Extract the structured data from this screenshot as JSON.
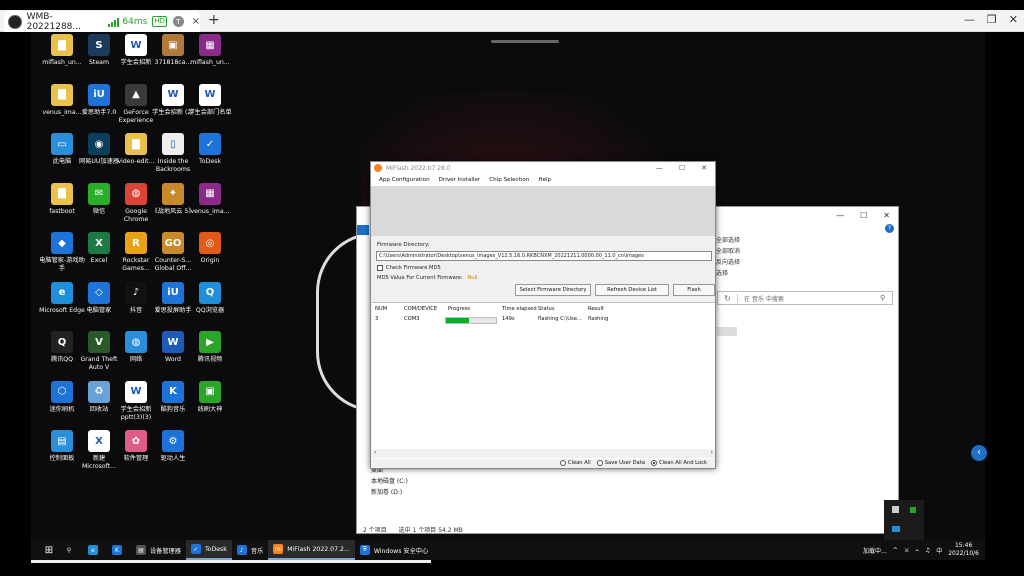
{
  "remote": {
    "tab_title": "WMB-20221288...",
    "ping": "64ms",
    "hd": "HD",
    "badge": "T",
    "close": "×",
    "new_tab": "+",
    "controls": [
      "—",
      "❐",
      "✕"
    ]
  },
  "desktop_icons": [
    {
      "name": "miflash_un...",
      "color": "#e8c24a",
      "glyph": "▇"
    },
    {
      "name": "Steam",
      "color": "#1b3a5c",
      "glyph": "S"
    },
    {
      "name": "学生会招新",
      "color": "#fff",
      "glyph": "W"
    },
    {
      "name": "371818ca...",
      "color": "#b07a3a",
      "glyph": "▣"
    },
    {
      "name": "miflash_un...",
      "color": "#8a2b8a",
      "glyph": "▦"
    },
    {
      "name": "venus_ima...",
      "color": "#e8c24a",
      "glyph": "▇"
    },
    {
      "name": "爱思助手7.0",
      "color": "#1e73d8",
      "glyph": "iU"
    },
    {
      "name": "GeForce Experience",
      "color": "#3a3a3a",
      "glyph": "▲"
    },
    {
      "name": "学生会招新 (2)",
      "color": "#fff",
      "glyph": "W"
    },
    {
      "name": "学生会部门名单",
      "color": "#fff",
      "glyph": "W"
    },
    {
      "name": "此电脑",
      "color": "#2a8fd8",
      "glyph": "▭"
    },
    {
      "name": "网易UU加速器",
      "color": "#0b3d5c",
      "glyph": "◉"
    },
    {
      "name": "video-edit...",
      "color": "#e8c24a",
      "glyph": "▇"
    },
    {
      "name": "Inside the Backrooms",
      "color": "#eee",
      "glyph": "▯"
    },
    {
      "name": "ToDesk",
      "color": "#1e73d8",
      "glyph": "✓"
    },
    {
      "name": "fastboot",
      "color": "#e8c24a",
      "glyph": "▇"
    },
    {
      "name": "微信",
      "color": "#2aae2a",
      "glyph": "✉"
    },
    {
      "name": "Google Chrome",
      "color": "#db4437",
      "glyph": "◍"
    },
    {
      "name": "《战地风云 5》",
      "color": "#c88a2a",
      "glyph": "✦"
    },
    {
      "name": "venus_ima...",
      "color": "#8a2b8a",
      "glyph": "▦"
    },
    {
      "name": "电脑管家-游戏助手",
      "color": "#1e73d8",
      "glyph": "◆"
    },
    {
      "name": "Excel",
      "color": "#1d7a45",
      "glyph": "X"
    },
    {
      "name": "Rockstar Games...",
      "color": "#e8a21a",
      "glyph": "R"
    },
    {
      "name": "Counter-S... Global Off...",
      "color": "#c88a2a",
      "glyph": "GO"
    },
    {
      "name": "Origin",
      "color": "#e05a1a",
      "glyph": "◎"
    },
    {
      "name": "Microsoft Edge",
      "color": "#1e8fd8",
      "glyph": "e"
    },
    {
      "name": "电脑管家",
      "color": "#1e73d8",
      "glyph": "◇"
    },
    {
      "name": "抖音",
      "color": "#111",
      "glyph": "♪"
    },
    {
      "name": "爱思投屏助手",
      "color": "#1e73d8",
      "glyph": "iU"
    },
    {
      "name": "QQ浏览器",
      "color": "#1e8fd8",
      "glyph": "Q"
    },
    {
      "name": "腾讯QQ",
      "color": "#222",
      "glyph": "Q"
    },
    {
      "name": "Grand Theft Auto V",
      "color": "#2a5a2a",
      "glyph": "V"
    },
    {
      "name": "网络",
      "color": "#2a8fd8",
      "glyph": "◍"
    },
    {
      "name": "Word",
      "color": "#1e5ab8",
      "glyph": "W"
    },
    {
      "name": "腾讯视频",
      "color": "#2aa52a",
      "glyph": "▶"
    },
    {
      "name": "迷你刷机",
      "color": "#1e73d8",
      "glyph": "⬡"
    },
    {
      "name": "回收站",
      "color": "#6aa2d8",
      "glyph": "♻"
    },
    {
      "name": "学生会招新pptt(3)(3)",
      "color": "#fff",
      "glyph": "W"
    },
    {
      "name": "酷狗音乐",
      "color": "#1e73d8",
      "glyph": "K"
    },
    {
      "name": "线刷大神",
      "color": "#2aa52a",
      "glyph": "▣"
    },
    {
      "name": "控制面板",
      "color": "#2a8fd8",
      "glyph": "▤"
    },
    {
      "name": "新建 Microsoft...",
      "color": "#fff",
      "glyph": "X"
    },
    {
      "name": "软件管理",
      "color": "#e05a8a",
      "glyph": "✿"
    },
    {
      "name": "驱动人生",
      "color": "#1e73d8",
      "glyph": "⚙"
    }
  ],
  "explorer": {
    "controls": [
      "—",
      "☐",
      "✕"
    ],
    "menu_right": [
      "全部选择",
      "全部取消",
      "反向选择"
    ],
    "select_label": "选择",
    "search_placeholder": "在 音乐 中搜索",
    "nav_items": [
      "桌面",
      "本地磁盘 (C:)",
      "新加卷 (D:)"
    ],
    "status": [
      "2 个项目",
      "选中 1 个项目  54.2 MB"
    ],
    "help": "?"
  },
  "miflash": {
    "title": "MiFlash 2022.07.28.0",
    "controls": [
      "—",
      "☐",
      "✕"
    ],
    "menu": [
      "App Configuration",
      "Driver Installer",
      "Chip Selection",
      "Help"
    ],
    "firmware_label": "Firmware Directory:",
    "firmware_path": "C:\\Users\\Administrator\\Desktop\\venus_images_V12.5.16.0.RKBCNXM_20221211.0000.00_11.0_cn\\images",
    "check_md5_label": "Check Firmware MD5",
    "md5_label": "MD5 Value For Current Firmware:",
    "md5_value": "Null",
    "buttons": [
      "Select Firmware Directory",
      "Refresh Device List",
      "Flash"
    ],
    "columns": [
      "NUM",
      "COM/DEVICE",
      "Progress",
      "Time elapsed",
      "Status",
      "Result"
    ],
    "rows": [
      {
        "num": "3",
        "device": "COM3",
        "progress": 0.45,
        "time": "149s",
        "status": "flashing C:\\Use...",
        "result": "flashing"
      }
    ],
    "scroll_left": "‹",
    "scroll_right": "›",
    "options": [
      {
        "label": "Clean All",
        "selected": false
      },
      {
        "label": "Save User Data",
        "selected": false
      },
      {
        "label": "Clean All And Lock",
        "selected": true
      }
    ]
  },
  "taskbar": {
    "start_icon": "windows-icon",
    "items": [
      {
        "label": "",
        "icon": "search-icon",
        "glyph": "⚲",
        "color": "#101010"
      },
      {
        "label": "",
        "icon": "edge-icon",
        "glyph": "e",
        "color": "#1e8fd8"
      },
      {
        "label": "",
        "icon": "kugou-icon",
        "glyph": "K",
        "color": "#1e73d8"
      },
      {
        "label": "设备管理器",
        "icon": "device-manager-icon",
        "glyph": "▤",
        "color": "#555"
      },
      {
        "label": "ToDesk",
        "icon": "todesk-icon",
        "glyph": "✓",
        "color": "#1e73d8",
        "active": true
      },
      {
        "label": "音乐",
        "icon": "music-icon",
        "glyph": "♪",
        "color": "#1e73d8"
      },
      {
        "label": "MiFlash 2022.07.2...",
        "icon": "miflash-icon",
        "glyph": "mi",
        "color": "#f58220",
        "active": true
      },
      {
        "label": "Windows 安全中心",
        "icon": "shield-icon",
        "glyph": "⛨",
        "color": "#1e73d8"
      }
    ],
    "tray_text": "加载中...",
    "tray_icons": [
      "^",
      "⚔",
      "⌁",
      "♫",
      "中"
    ],
    "time": "15:46",
    "date": "2022/10/6"
  }
}
